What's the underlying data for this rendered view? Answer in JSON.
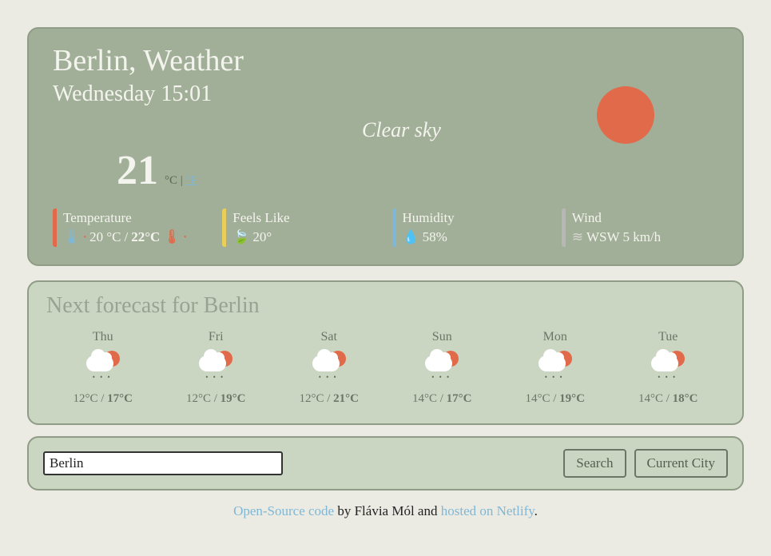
{
  "header": {
    "title": "Berlin, Weather",
    "datetime": "Wednesday 15:01",
    "description": "Clear sky",
    "temp": "21",
    "unit_c": "°C",
    "unit_sep": " | ",
    "unit_f": "°F"
  },
  "stats": {
    "temperature": {
      "label": "Temperature",
      "low": "20 °C",
      "sep": " / ",
      "high": "22°C"
    },
    "feels": {
      "label": "Feels Like",
      "value": "20°"
    },
    "humidity": {
      "label": "Humidity",
      "value": "58%"
    },
    "wind": {
      "label": "Wind",
      "value": "WSW 5 km/h"
    }
  },
  "forecast": {
    "title": "Next forecast for Berlin",
    "days": [
      {
        "name": "Thu",
        "low": "12°C",
        "high": "17°C"
      },
      {
        "name": "Fri",
        "low": "12°C",
        "high": "19°C"
      },
      {
        "name": "Sat",
        "low": "12°C",
        "high": "21°C"
      },
      {
        "name": "Sun",
        "low": "14°C",
        "high": "17°C"
      },
      {
        "name": "Mon",
        "low": "14°C",
        "high": "19°C"
      },
      {
        "name": "Tue",
        "low": "14°C",
        "high": "18°C"
      }
    ]
  },
  "search": {
    "value": "Berlin",
    "search_label": "Search",
    "current_label": "Current City"
  },
  "footer": {
    "link1": "Open-Source code",
    "mid": " by Flávia Mól and ",
    "link2": "hosted on Netlify",
    "end": "."
  }
}
